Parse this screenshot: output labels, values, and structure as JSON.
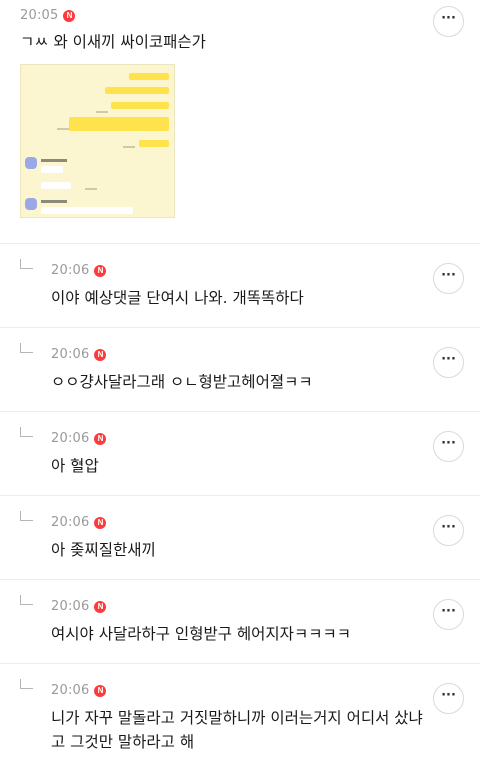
{
  "main_post": {
    "time": "20:05",
    "badge": "N",
    "text": "ㄱㅆ 와 이새끼 싸이코패슨가",
    "image_icon": "chat-screenshot-thumbnail",
    "more_label": "···"
  },
  "replies": [
    {
      "time": "20:06",
      "badge": "N",
      "text": "이야 예상댓글 단여시 나와. 개똑똑하다",
      "more_label": "···"
    },
    {
      "time": "20:06",
      "badge": "N",
      "text": "ㅇㅇ걍사달라그래 ㅇㄴ형받고헤어졀ㅋㅋ",
      "more_label": "···"
    },
    {
      "time": "20:06",
      "badge": "N",
      "text": "아 혈압",
      "more_label": "···"
    },
    {
      "time": "20:06",
      "badge": "N",
      "text": "아 좆찌질한새끼",
      "more_label": "···"
    },
    {
      "time": "20:06",
      "badge": "N",
      "text": "여시야 사달라하구 인형받구 헤어지자ㅋㅋㅋㅋ",
      "more_label": "···"
    },
    {
      "time": "20:06",
      "badge": "N",
      "text": "니가 자꾸 말돌라고 거짓말하니까 이러는거지 어디서 샀냐고 그것만 말하라고 해",
      "more_label": "···"
    }
  ],
  "colors": {
    "badge": "#ff3a3a",
    "thumbnail_bg": "#fbf6cf",
    "yellow_bubble": "#ffe34d"
  }
}
